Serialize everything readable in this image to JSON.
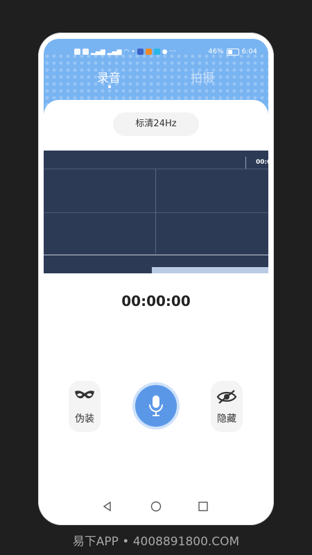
{
  "status": {
    "battery": "46%",
    "time": "6:04",
    "overflow": "···"
  },
  "tabs": [
    {
      "label": "录音",
      "active": true
    },
    {
      "label": "拍摄",
      "active": false
    }
  ],
  "quality": {
    "label": "标清24Hz"
  },
  "scope": {
    "timestamp": "00:0",
    "progress": 0.48
  },
  "timer": {
    "value": "00:00:00"
  },
  "actions": {
    "disguise": {
      "label": "伪装",
      "icon": "mask-icon"
    },
    "record": {
      "icon": "microphone-icon"
    },
    "hide": {
      "label": "隐藏",
      "icon": "eye-off-icon"
    }
  },
  "bottom_nav": [
    {
      "icon": "home-icon",
      "active": true
    },
    {
      "icon": "grid-icon",
      "active": false
    },
    {
      "icon": "user-icon",
      "active": false
    }
  ],
  "system_nav": [
    "back-icon",
    "home-circle-icon",
    "recents-icon"
  ],
  "watermark": {
    "text": "易下APP • 4008891800.COM"
  },
  "colors": {
    "accent": "#5a97e6",
    "header": "#79b4f2",
    "scope_bg": "#2c3a56",
    "progress": "#b9cbe4"
  }
}
